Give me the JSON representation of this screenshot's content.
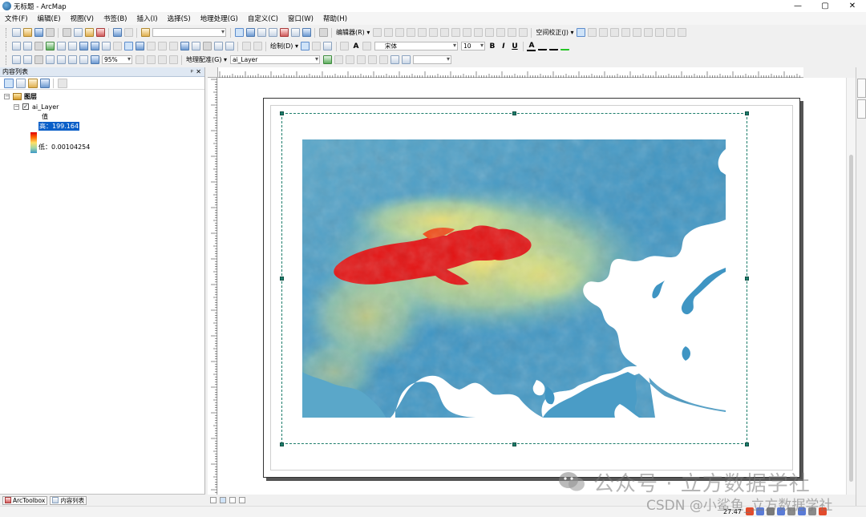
{
  "window": {
    "title": "无标题 - ArcMap",
    "controls": [
      "—",
      "▢",
      "✕"
    ]
  },
  "menu": [
    "文件(F)",
    "编辑(E)",
    "视图(V)",
    "书签(B)",
    "插入(I)",
    "选择(S)",
    "地理处理(G)",
    "自定义(C)",
    "窗口(W)",
    "帮助(H)"
  ],
  "toolbars": {
    "editor_label": "编辑器(R) ▾",
    "spatial_adjust_label": "空间校正(J) ▾",
    "draw_label": "绘制(D) ▾",
    "font_name": "宋体",
    "font_size": "10",
    "zoom_level": "95%",
    "georef_label": "地理配准(G) ▾",
    "georef_layer": "ai_Layer",
    "bold": "B",
    "italic": "I",
    "underline": "U",
    "text_a": "A"
  },
  "toc": {
    "title": "内容列表",
    "pin": "ᵖ",
    "close": "✕",
    "expand_minus": "−",
    "checked": "✓",
    "layers_group": "图层",
    "layer_name": "ai_Layer",
    "value_label": "值",
    "high_label": "高：199.164",
    "low_label": "低：0.00104254"
  },
  "bottom_tabs": {
    "arctoolbox": "ArcToolbox",
    "toc": "内容列表"
  },
  "status": {
    "coordinates": "27.47"
  },
  "watermark": {
    "line1": "公众号 · 立方数据学社",
    "line2": "CSDN @小鲨鱼_立方数据学社"
  },
  "colors": {
    "frame": "#1d7d6b",
    "high": "#e00000",
    "mid": "#ffe066",
    "low": "#3b98c8"
  }
}
